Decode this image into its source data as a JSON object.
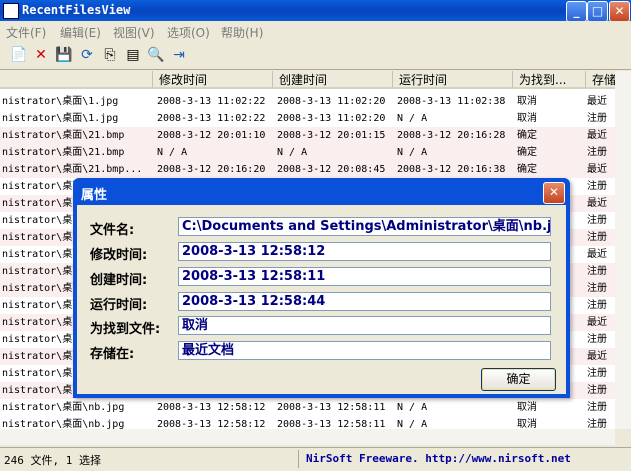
{
  "window": {
    "title": "RecentFilesView",
    "min_icon": "minimize-icon",
    "max_icon": "maximize-icon",
    "close_icon": "close-icon"
  },
  "menu": [
    {
      "label": "文件(F)"
    },
    {
      "label": "编辑(E)"
    },
    {
      "label": "视图(V)"
    },
    {
      "label": "选项(O)"
    },
    {
      "label": "帮助(H)"
    }
  ],
  "toolbar_icons": [
    "document-icon",
    "delete-icon",
    "save-icon",
    "refresh-icon",
    "copy-icon",
    "properties-icon",
    "find-icon",
    "exit-icon"
  ],
  "columns": [
    "",
    "修改时间",
    "创建时间",
    "运行时间",
    "为找到...",
    "存储"
  ],
  "rows": [
    [
      "nistrator\\桌面\\1.jpg",
      "2008-3-13 11:02:22",
      "2008-3-13 11:02:20",
      "2008-3-13 11:02:38",
      "取消",
      "最近"
    ],
    [
      "nistrator\\桌面\\1.jpg",
      "2008-3-13 11:02:22",
      "2008-3-13 11:02:20",
      "N / A",
      "取消",
      "注册"
    ],
    [
      "nistrator\\桌面\\21.bmp",
      "2008-3-12 20:01:10",
      "2008-3-12 20:01:15",
      "2008-3-12 20:16:28",
      "确定",
      "最近"
    ],
    [
      "nistrator\\桌面\\21.bmp",
      "N / A",
      "N / A",
      "N / A",
      "确定",
      "注册"
    ],
    [
      "nistrator\\桌面\\21.bmp...",
      "2008-3-12 20:16:20",
      "2008-3-12 20:08:45",
      "2008-3-12 20:16:38",
      "确定",
      "最近"
    ],
    [
      "nistrator\\桌面",
      "",
      "",
      "",
      "",
      "注册"
    ],
    [
      "nistrator\\桌面",
      "",
      "",
      "",
      "",
      "最近"
    ],
    [
      "nistrator\\桌面",
      "",
      "",
      "",
      "",
      "注册"
    ],
    [
      "nistrator\\桌面",
      "",
      "",
      "",
      "",
      "注册"
    ],
    [
      "nistrator\\桌面",
      "",
      "",
      "",
      "",
      "最近"
    ],
    [
      "nistrator\\桌面",
      "",
      "",
      "",
      "",
      "注册"
    ],
    [
      "nistrator\\桌面",
      "",
      "",
      "",
      "",
      "注册"
    ],
    [
      "nistrator\\桌面",
      "",
      "",
      "",
      "",
      "注册"
    ],
    [
      "nistrator\\桌面",
      "",
      "",
      "",
      "",
      "最近"
    ],
    [
      "nistrator\\桌面",
      "",
      "",
      "",
      "",
      "注册"
    ],
    [
      "nistrator\\桌面",
      "",
      "",
      "",
      "",
      "最近"
    ],
    [
      "nistrator\\桌面",
      "",
      "",
      "",
      "",
      "注册"
    ],
    [
      "nistrator\\桌面",
      "",
      "",
      "",
      "",
      "注册"
    ],
    [
      "nistrator\\桌面\\nb.jpg",
      "2008-3-13 12:58:12",
      "2008-3-13 12:58:11",
      "N / A",
      "取消",
      "注册"
    ],
    [
      "nistrator\\桌面\\nb.jpg",
      "2008-3-13 12:58:12",
      "2008-3-13 12:58:11",
      "N / A",
      "取消",
      "注册"
    ]
  ],
  "dialog": {
    "title": "属性",
    "close_icon": "close-icon",
    "fields": [
      {
        "label": "文件名:",
        "value": "C:\\Documents and Settings\\Administrator\\桌面\\nb.jpg"
      },
      {
        "label": "修改时间:",
        "value": "2008-3-13 12:58:12"
      },
      {
        "label": "创建时间:",
        "value": "2008-3-13 12:58:11"
      },
      {
        "label": "运行时间:",
        "value": "2008-3-13 12:58:44"
      },
      {
        "label": "为找到文件:",
        "value": "取消"
      },
      {
        "label": "存储在:",
        "value": "最近文档"
      }
    ],
    "ok_label": "确定"
  },
  "status": {
    "count": "246 文件, 1 选择",
    "brand": "NirSoft Freeware.  http://www.nirsoft.net"
  }
}
